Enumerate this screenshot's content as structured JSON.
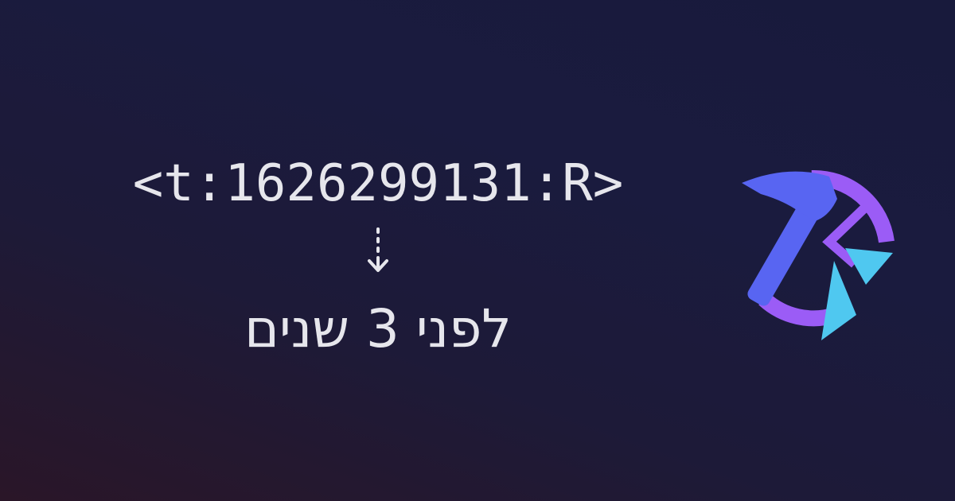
{
  "timestamp_code": "<t:1626299131:R>",
  "relative_time": "לפני 3 שנים",
  "icons": {
    "arrow": "dotted-down-arrow-icon",
    "logo": "hammer-clock-logo-icon"
  },
  "colors": {
    "text": "#e6e6ec",
    "hammer": "#5865f2",
    "ring": "#9b5cf6",
    "shard": "#4fc8f0"
  }
}
